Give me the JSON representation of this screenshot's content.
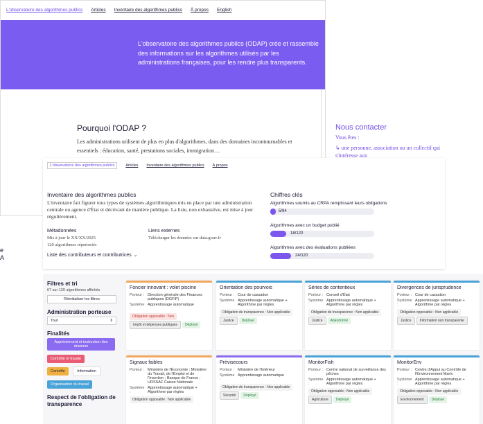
{
  "nav1": {
    "brand": "L'observatoire des algorithmes publics",
    "links": [
      "Articles",
      "Inventaire des algorithmes publics",
      "À propos",
      "English"
    ]
  },
  "hero": {
    "text": "L'observatoire des algorithmes publics (ODAP) crée et rassemble des informations sur les algorithmes utilisés par les administrations françaises, pour les rendre plus transparents.",
    "color": "#7b5cf0"
  },
  "why": {
    "title": "Pourquoi l'ODAP ?",
    "text": "Les administrations utilisent de plus en plus d'algorithmes, dans des domaines incontournables et essentiels : éducation, santé, prestations sociales, immigration…"
  },
  "contact": {
    "title": "Nous contacter",
    "youare": "Vous êtes :",
    "option": "une personne, association ou un collectif qui s'intéresse aux"
  },
  "nav2": {
    "brand": "L'observatoire des algorithmes publics",
    "links": [
      "Articles",
      "Inventaire des algorithmes publics",
      "À propos"
    ]
  },
  "inventory": {
    "title": "Inventaire des algorithmes publics",
    "text": "L'inventaire fait figurer tous types de systèmes algorithmiques mis en place par une administration centrale ou agence d'État et décrivant de manière publique. La liste, non exhaustive, est mise à jour régulièrement.",
    "meta_title": "Métadonnées",
    "meta_lines": [
      "Mis à jour le XX/XX/2025",
      "120 algorithmes répertoriés"
    ],
    "links_title": "Liens externes",
    "links_text": "Télécharger les données sur data.gouv.fr",
    "contributors": "Liste des contributeurs et contributrices"
  },
  "stats": {
    "title": "Chiffres clés",
    "items": [
      {
        "label": "Algorithmes soumis au CRPA remplissant leurs obligations",
        "value": "5/94",
        "fraction": 0.053
      },
      {
        "label": "Algorithmes avec un budget publié",
        "value": "18/120",
        "fraction": 0.15
      },
      {
        "label": "Algorithmes avec des évaluations publiées",
        "value": "24/120",
        "fraction": 0.2
      }
    ]
  },
  "cutoff_text": [
    "e",
    "A"
  ],
  "filters": {
    "title": "Filtres et tri",
    "count": "67 sur 120 algorithmes affichés",
    "reset": "Réinitialiser les filtres",
    "admin_label": "Administration porteuse",
    "admin_value": "Tout",
    "final_label": "Finalités",
    "chips": [
      {
        "label": "Appréciement et instruction des dossiers",
        "color": "#8b6cf0"
      },
      {
        "label": "Contrôle et fraude",
        "color": "#e85d75"
      },
      {
        "label": "Contrôle",
        "color": "#f0b040"
      },
      {
        "label": "Information",
        "color": "#ffffff"
      },
      {
        "label": "Organisation du travail",
        "color": "#4aa3d8"
      }
    ],
    "respect_label": "Respect de l'obligation de transparence"
  },
  "cards": [
    {
      "title": "Foncier innovant : volet piscine",
      "k1": "Porteur :",
      "v1": "Direction générale des Finances publiques (DGFiP)",
      "k2": "Système :",
      "v2": "Apprentissage automatique",
      "tags": [
        [
          "Obligation opposable : Non",
          "t-red"
        ],
        [
          "Impôt et dépenses publiques",
          "t-grey"
        ],
        [
          "Déployé",
          "t-green"
        ]
      ],
      "color": "#f0a860"
    },
    {
      "title": "Orientation des pourvois",
      "k1": "Porteur :",
      "v1": "Cour de cassation",
      "k2": "Système :",
      "v2": "Apprentissage automatique + Algorithme par règles",
      "tags": [
        [
          "Obligation de transparence : Non applicable",
          "t-plain"
        ],
        [
          "Justice",
          "t-grey"
        ],
        [
          "Déployé",
          "t-green"
        ]
      ],
      "color": "#4aa3d8"
    },
    {
      "title": "Séries de contentieux",
      "k1": "Porteur :",
      "v1": "Conseil d'État",
      "k2": "Système :",
      "v2": "Apprentissage automatique + Algorithme par règles",
      "tags": [
        [
          "Obligation de transparence : Non applicable",
          "t-plain"
        ],
        [
          "Justice",
          "t-grey"
        ],
        [
          "Abandonné",
          "t-green"
        ]
      ],
      "color": "#4aa3d8"
    },
    {
      "title": "Divergences de jurisprudence",
      "k1": "Porteur :",
      "v1": "Cour de cassation",
      "k2": "Système :",
      "v2": "Apprentissage automatique + Algorithme par règles",
      "tags": [
        [
          "Obligation opposable : Non applicable",
          "t-plain"
        ],
        [
          "Justice",
          "t-grey"
        ],
        [
          "Information non transparente",
          "t-grey"
        ]
      ],
      "color": "#4aa3d8"
    },
    {
      "title": "Signaux faibles",
      "k1": "Porteur :",
      "v1": "Ministère de l'Économie ; Ministère du Travail, de l'Emploi et de l'Insertion ; Banque de France ; URSSAF Caisse Nationale",
      "k2": "Système :",
      "v2": "Apprentissage automatique + Algorithme par règles",
      "tags": [
        [
          "Obligation opposable : Non applicable",
          "t-plain"
        ]
      ],
      "color": "#f0a860"
    },
    {
      "title": "Prévisecours",
      "k1": "Porteur :",
      "v1": "Ministère de l'Intérieur",
      "k2": "Système :",
      "v2": "Apprentissage automatique",
      "tags": [
        [
          "Obligation de transparence : Non applicable",
          "t-plain"
        ],
        [
          "Sécurité",
          "t-grey"
        ],
        [
          "Déployé",
          "t-green"
        ]
      ],
      "color": "#8b6cf0"
    },
    {
      "title": "MonitorFish",
      "k1": "Porteur :",
      "v1": "Centre national de surveillance des pêches",
      "k2": "Système :",
      "v2": "Apprentissage automatique + Algorithme par règles",
      "tags": [
        [
          "Obligation opposable : Non applicable",
          "t-plain"
        ],
        [
          "Agriculture",
          "t-grey"
        ],
        [
          "Déployé",
          "t-green"
        ]
      ],
      "color": "#4aa3d8"
    },
    {
      "title": "MonitorEnv",
      "k1": "Porteur :",
      "v1": "Centre d'Appui au Contrôle de l'Environnement Marin",
      "k2": "Système :",
      "v2": "Apprentissage automatique + Algorithme par règles",
      "tags": [
        [
          "Obligation opposable : Non applicable",
          "t-plain"
        ],
        [
          "Environnement",
          "t-grey"
        ],
        [
          "Déployé",
          "t-green"
        ]
      ],
      "color": "#4aa3d8"
    }
  ]
}
